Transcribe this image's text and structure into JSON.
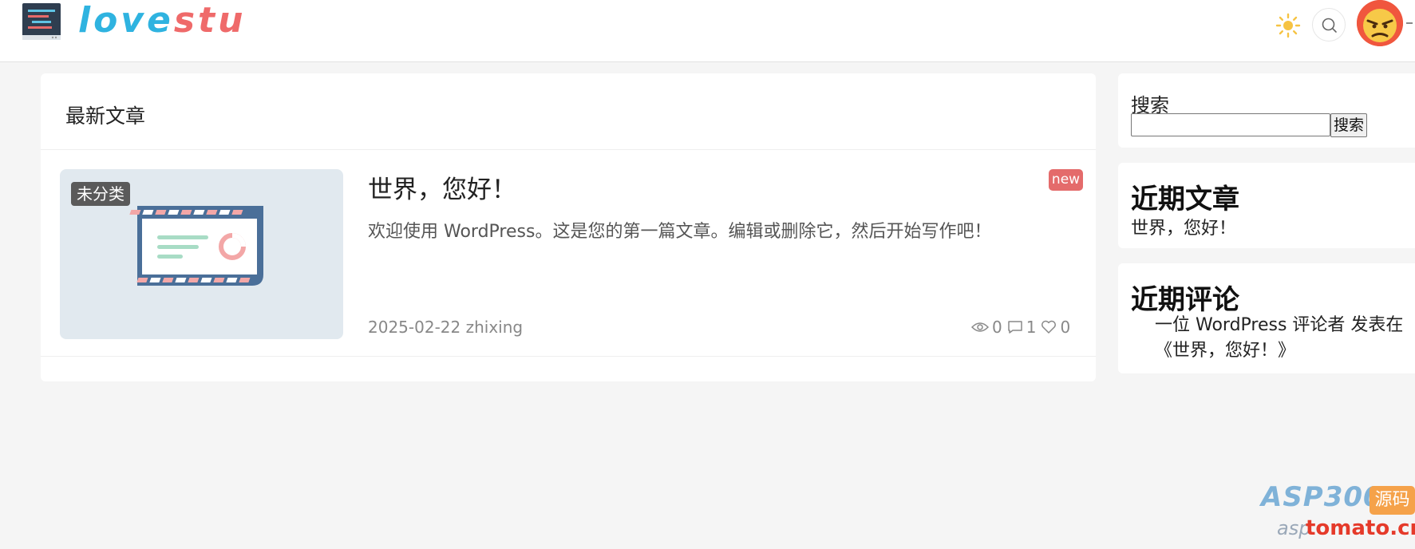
{
  "header": {
    "logo_text_part1": "love",
    "logo_text_part2": "stu"
  },
  "main": {
    "section_title": "最新文章",
    "post": {
      "category": "未分类",
      "title": "世界，您好！",
      "badge": "new",
      "excerpt": "欢迎使用 WordPress。这是您的第一篇文章。编辑或删除它，然后开始写作吧！",
      "date": "2025-02-22",
      "author": "zhixing",
      "views": "0",
      "comments": "1",
      "likes": "0"
    }
  },
  "sidebar": {
    "search_label": "搜索",
    "search_value": "",
    "search_button": "搜索",
    "recent_posts_heading": "近期文章",
    "recent_posts": [
      "世界，您好！"
    ],
    "recent_comments_heading": "近期评论",
    "recent_comment_text": "一位 WordPress 评论者 发表在《世界，您好！》"
  },
  "watermark": {
    "brand": "ASP300",
    "tag": "源码",
    "site_partial": "asp",
    "site": "tomato.cm"
  },
  "colors": {
    "logo_blue": "#2fb3e0",
    "logo_red": "#ef6a6a",
    "badge_red": "#e46b6b",
    "page_bg": "#f5f5f5"
  }
}
